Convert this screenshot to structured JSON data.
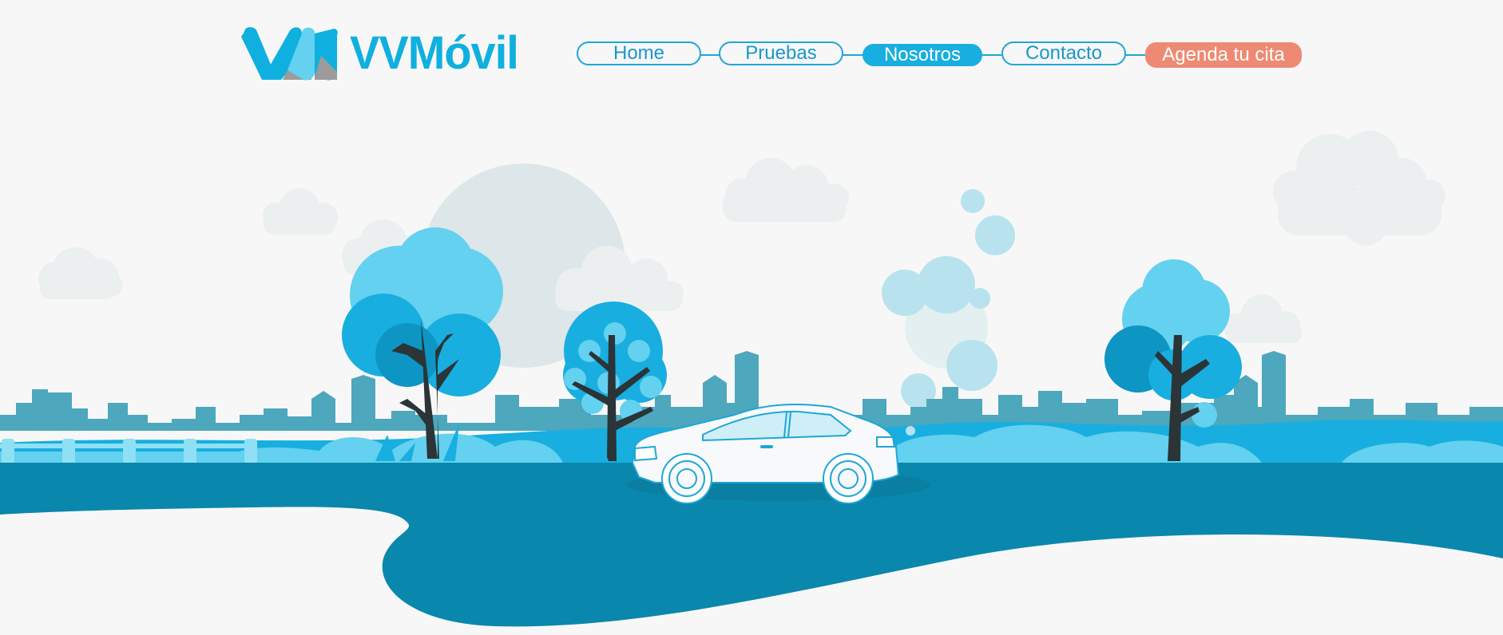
{
  "brand": {
    "name": "VVMóvil",
    "colors": {
      "primary": "#0fb0df",
      "accent": "#ee8a74",
      "dark_teal": "#0a87ac",
      "grey": "#9b9b9b"
    }
  },
  "nav": {
    "items": [
      {
        "label": "Home",
        "state": "default"
      },
      {
        "label": "Pruebas",
        "state": "default"
      },
      {
        "label": "Nosotros",
        "state": "active"
      },
      {
        "label": "Contacto",
        "state": "default"
      }
    ],
    "cta_label": "Agenda tu cita"
  },
  "hero": {
    "illustration": "city-park-car-scene",
    "icons": [
      "sun-icon",
      "cloud-icon",
      "tree-icon",
      "car-icon",
      "skyline-icon",
      "fence-icon",
      "smoke-icon"
    ]
  }
}
